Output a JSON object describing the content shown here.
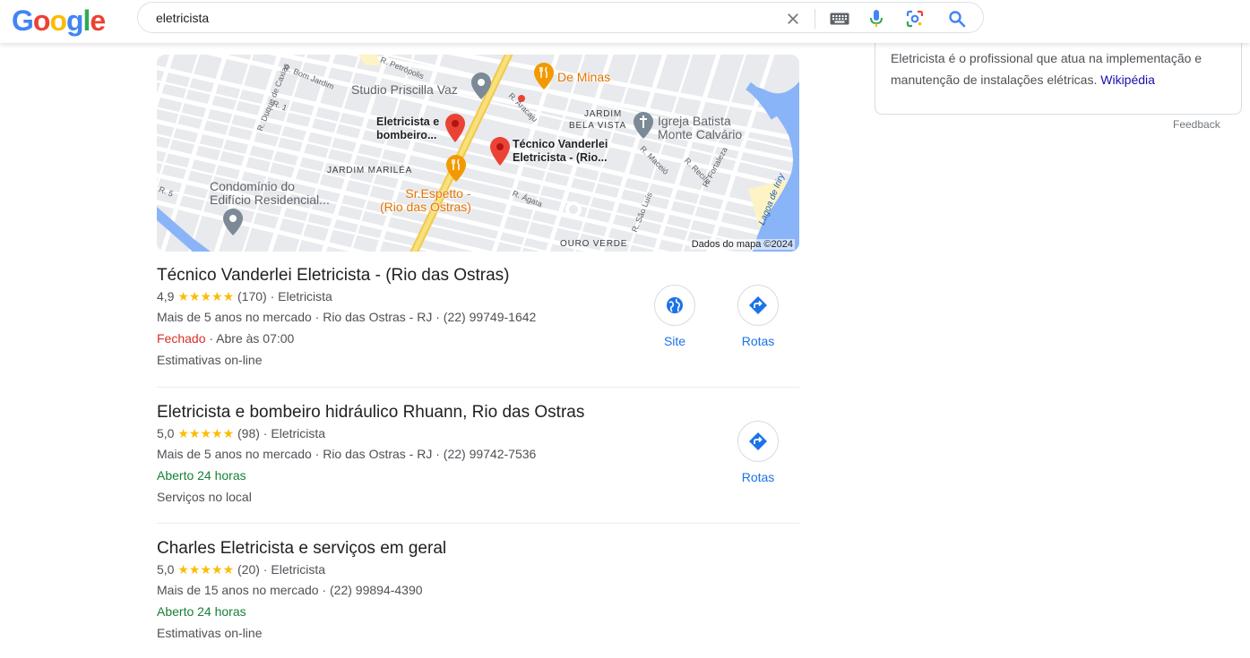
{
  "logo": {
    "letters": [
      "G",
      "o",
      "o",
      "g",
      "l",
      "e"
    ]
  },
  "search": {
    "query": "eletricista"
  },
  "map": {
    "labels": {
      "petropolis": "R. Petrópolis",
      "bom_jardim": "R. Bom Jardim",
      "r1": "R. 1",
      "duque": "R. Duque de Caxias",
      "r5": "R. 5",
      "studio": "Studio Priscilla Vaz",
      "de_minas": "De Minas",
      "aracaju": "R. Aracaju",
      "jardim_bela_vista_1": "JARDIM",
      "jardim_bela_vista_2": "BELA VISTA",
      "igreja_1": "Igreja Batista",
      "igreja_2": "Monte Calvário",
      "eletricista_pin_1": "Eletricista e",
      "eletricista_pin_2": "bombeiro...",
      "tecnico_pin_1": "Técnico Vanderlei",
      "tecnico_pin_2": "Eletricista -  (Rio...",
      "jardim_marilea": "JARDIM MARILÉA",
      "condominio_1": "Condomínio do",
      "condominio_2": "Edifício Residencial...",
      "espetto_1": "Sr.Espetto -",
      "espetto_2": "(Rio das Ostras)",
      "agata": "R. Ágata",
      "maceio": "R. Maceió",
      "recife": "R. Recife",
      "fortaleza": "R. Fortaleza",
      "sao_luis": "R. São Luís",
      "lagoa": "Lagoa de Iriry",
      "ouro_verde": "OURO VERDE"
    },
    "copyright": "Dados do mapa ©2024"
  },
  "results": [
    {
      "title": "Técnico Vanderlei Eletricista - (Rio das Ostras)",
      "rating": "4,9",
      "stars": "★★★★★",
      "reviews": "(170)",
      "category": "Eletricista",
      "line2": "Mais de 5 anos no mercado · Rio das Ostras - RJ · (22) 99749-1642",
      "status": "Fechado",
      "status_extra": " · Abre às 07:00",
      "line4": "Estimativas on-line",
      "actions": {
        "site": "Site",
        "rotas": "Rotas"
      }
    },
    {
      "title": "Eletricista e bombeiro hidráulico Rhuann, Rio das Ostras",
      "rating": "5,0",
      "stars": "★★★★★",
      "reviews": "(98)",
      "category": "Eletricista",
      "line2": "Mais de 5 anos no mercado · Rio das Ostras - RJ · (22) 99742-7536",
      "status": "Aberto 24 horas",
      "line4": "Serviços no local",
      "actions": {
        "rotas": "Rotas"
      }
    },
    {
      "title": "Charles Eletricista e serviços em geral",
      "rating": "5,0",
      "stars": "★★★★★",
      "reviews": "(20)",
      "category": "Eletricista",
      "line2": "Mais de 15 anos no mercado · (22) 99894-4390",
      "status": "Aberto 24 horas",
      "line4": "Estimativas on-line"
    }
  ],
  "knowledge": {
    "description": "Eletricista é o profissional que atua na implementação e manutenção de instalações elétricas.",
    "source": "Wikipédia",
    "feedback": "Feedback"
  },
  "colors": {
    "link": "#1a0dab",
    "action_blue": "#1a73e8",
    "closed_red": "#d93025",
    "open_green": "#188038",
    "star": "#fbbc04"
  }
}
